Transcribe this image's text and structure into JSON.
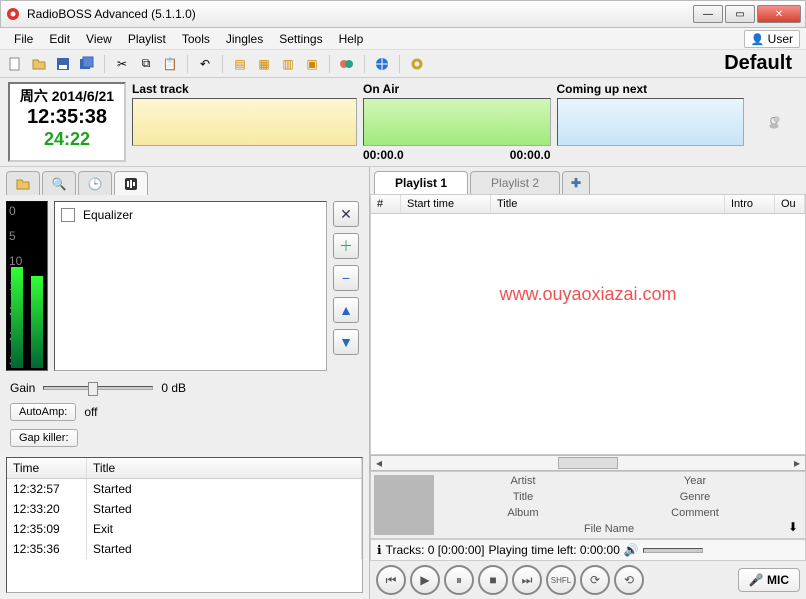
{
  "window": {
    "title": "RadioBOSS Advanced (5.1.1.0)"
  },
  "menu": [
    "File",
    "Edit",
    "View",
    "Playlist",
    "Tools",
    "Jingles",
    "Settings",
    "Help"
  ],
  "user_label": "User",
  "default_label": "Default",
  "clock": {
    "date": "周六 2014/6/21",
    "time": "12:35:38",
    "countdown": "24:22"
  },
  "strip": {
    "last_label": "Last track",
    "onair_label": "On Air",
    "next_label": "Coming up next",
    "elapsed": "00:00.0",
    "remain": "00:00.0"
  },
  "eq": {
    "row_label": "Equalizer",
    "gain_label": "Gain",
    "gain_value": "0 dB",
    "autoamp_label": "AutoAmp:",
    "autoamp_state": "off",
    "gapkiller_label": "Gap killer:",
    "vu_ticks": [
      "0",
      "5",
      "10",
      "15",
      "20",
      "25",
      "30"
    ]
  },
  "log": {
    "cols": {
      "time": "Time",
      "title": "Title"
    },
    "rows": [
      {
        "time": "12:32:57",
        "title": "Started"
      },
      {
        "time": "12:33:20",
        "title": "Started"
      },
      {
        "time": "12:35:09",
        "title": "Exit"
      },
      {
        "time": "12:35:36",
        "title": "Started"
      }
    ]
  },
  "playlist": {
    "tabs": [
      "Playlist 1",
      "Playlist 2"
    ],
    "cols": {
      "num": "#",
      "start": "Start time",
      "title": "Title",
      "intro": "Intro",
      "outro": "Ou"
    }
  },
  "watermark": "www.ouyaoxiazai.com",
  "info": {
    "artist": "Artist",
    "year": "Year",
    "ttl": "Title",
    "genre": "Genre",
    "album": "Album",
    "comment": "Comment",
    "filename": "File Name"
  },
  "status": {
    "tracks": "Tracks: 0 [0:00:00]",
    "playing": "Playing time left: 0:00:00"
  },
  "mic_label": "MIC"
}
